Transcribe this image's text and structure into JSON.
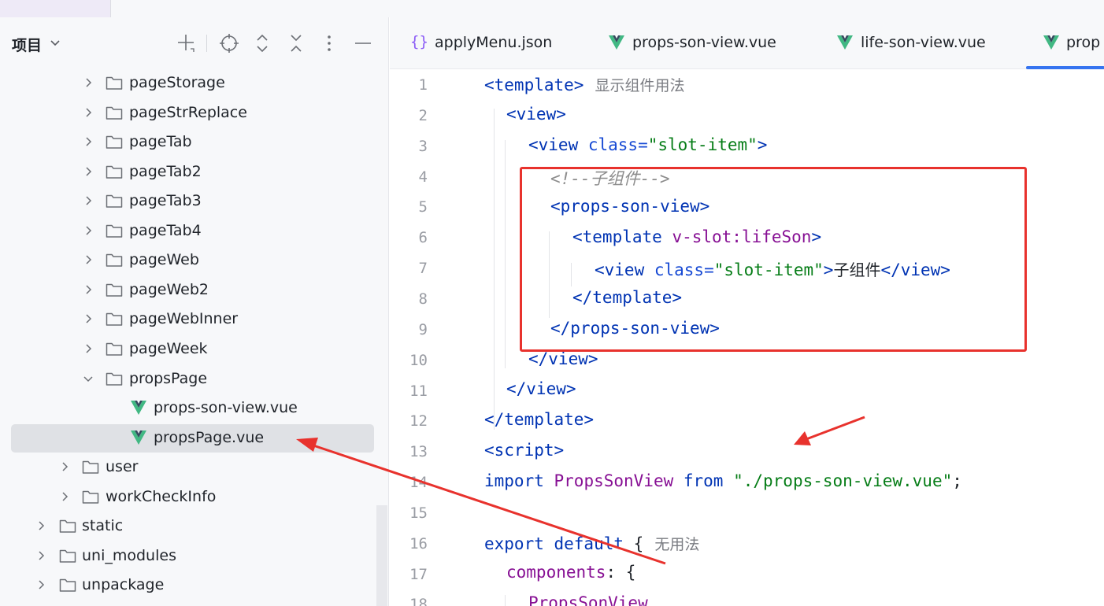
{
  "project_panel": {
    "title": "项目",
    "tools": [
      "add-icon",
      "locate-icon",
      "expand-all-icon",
      "collapse-all-icon",
      "more-icon",
      "hide-icon"
    ]
  },
  "tree": [
    {
      "label": "pageStorage",
      "type": "folder",
      "depth": 2,
      "expanded": false
    },
    {
      "label": "pageStrReplace",
      "type": "folder",
      "depth": 2,
      "expanded": false
    },
    {
      "label": "pageTab",
      "type": "folder",
      "depth": 2,
      "expanded": false
    },
    {
      "label": "pageTab2",
      "type": "folder",
      "depth": 2,
      "expanded": false
    },
    {
      "label": "pageTab3",
      "type": "folder",
      "depth": 2,
      "expanded": false
    },
    {
      "label": "pageTab4",
      "type": "folder",
      "depth": 2,
      "expanded": false
    },
    {
      "label": "pageWeb",
      "type": "folder",
      "depth": 2,
      "expanded": false
    },
    {
      "label": "pageWeb2",
      "type": "folder",
      "depth": 2,
      "expanded": false
    },
    {
      "label": "pageWebInner",
      "type": "folder",
      "depth": 2,
      "expanded": false
    },
    {
      "label": "pageWeek",
      "type": "folder",
      "depth": 2,
      "expanded": false
    },
    {
      "label": "propsPage",
      "type": "folder",
      "depth": 2,
      "expanded": true
    },
    {
      "label": "props-son-view.vue",
      "type": "vue",
      "depth": 3
    },
    {
      "label": "propsPage.vue",
      "type": "vue",
      "depth": 3,
      "selected": true
    },
    {
      "label": "user",
      "type": "folder",
      "depth": 1,
      "expanded": false
    },
    {
      "label": "workCheckInfo",
      "type": "folder",
      "depth": 1,
      "expanded": false
    },
    {
      "label": "static",
      "type": "folder",
      "depth": 0,
      "expanded": false
    },
    {
      "label": "uni_modules",
      "type": "folder",
      "depth": 0,
      "expanded": false
    },
    {
      "label": "unpackage",
      "type": "folder",
      "depth": 0,
      "expanded": false
    }
  ],
  "tabs": [
    {
      "label": "applyMenu.json",
      "icon": "json-icon"
    },
    {
      "label": "props-son-view.vue",
      "icon": "vue-icon"
    },
    {
      "label": "life-son-view.vue",
      "icon": "vue-icon"
    },
    {
      "label": "prop",
      "icon": "vue-icon",
      "active": true
    }
  ],
  "code": {
    "lines": [
      "1",
      "2",
      "3",
      "4",
      "5",
      "6",
      "7",
      "8",
      "9",
      "10",
      "11",
      "12",
      "13",
      "14",
      "15",
      "16",
      "17",
      "18"
    ],
    "l1_tag": "<template>",
    "l1_hint": "显示组件用法",
    "l2_tag": "<view>",
    "l3_open": "<view ",
    "l3_attr": "class=",
    "l3_val": "\"slot-item\"",
    "l3_close": ">",
    "l4_comment": "<!--子组件-->",
    "l5_tag": "<props-son-view>",
    "l6_open": "<template ",
    "l6_dir": "v-slot:lifeSon",
    "l6_close": ">",
    "l7_open": "<view ",
    "l7_attr": "class=",
    "l7_val": "\"slot-item\"",
    "l7_gt": ">",
    "l7_text": "子组件",
    "l7_end": "</view>",
    "l8_tag": "</template>",
    "l9_tag": "</props-son-view>",
    "l10_tag": "</view>",
    "l11_tag": "</view>",
    "l12_tag": "</template>",
    "l13_tag": "<script>",
    "l14_import": "import ",
    "l14_id": "PropsSonView",
    "l14_from": " from ",
    "l14_str": "\"./props-son-view.vue\"",
    "l14_semi": ";",
    "l16_export": "export default ",
    "l16_brace": "{",
    "l16_hint": "无用法",
    "l17_prop": "components",
    "l17_rest": ": {",
    "l18_id": "PropsSonView"
  },
  "colors": {
    "tag": "#0033b3",
    "string": "#067d17",
    "directive": "#871094",
    "annotation": "#e8322d",
    "accent": "#3574f0",
    "vue_green": "#41b883",
    "vue_dark": "#35495e"
  }
}
